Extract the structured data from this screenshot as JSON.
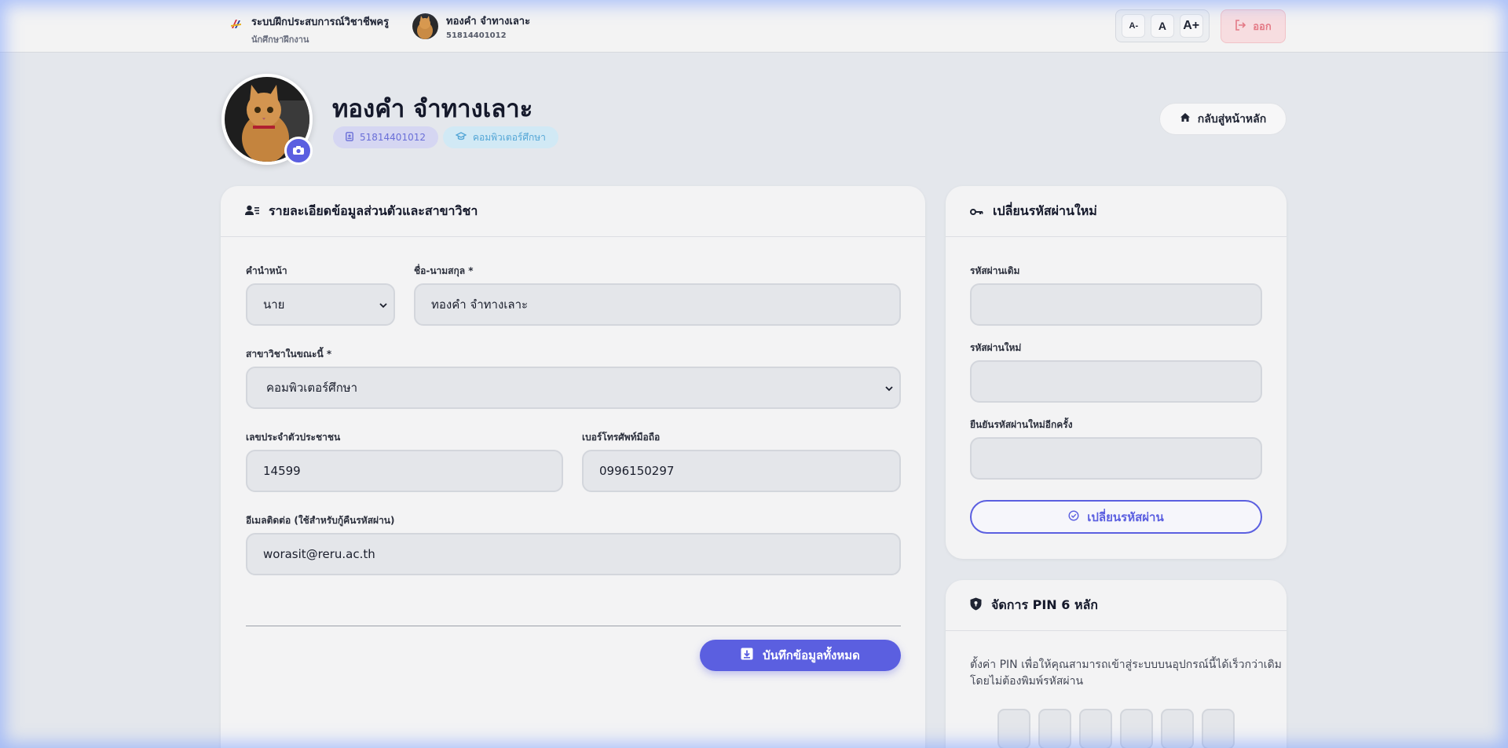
{
  "header": {
    "system_title": "ระบบฝึกประสบการณ์วิชาชีพครู",
    "role": "นักศึกษาฝึกงาน",
    "user_name": "ทองคำ จำทางเลาะ",
    "user_id": "51814401012",
    "font_controls": [
      "A-",
      "A",
      "A+"
    ],
    "logout_label": "ออก"
  },
  "profile": {
    "name": "ทองคำ จำทางเลาะ",
    "student_id": "51814401012",
    "major": "คอมพิวเตอร์ศึกษา",
    "home_label": "กลับสู่หน้าหลัก"
  },
  "details_card": {
    "title": "รายละเอียดข้อมูลส่วนตัวและสาขาวิชา",
    "prefix_label": "คำนำหน้า",
    "prefix_value": "นาย",
    "fullname_label": "ชื่อ-นามสกุล *",
    "fullname_value": "ทองคำ จำทางเลาะ",
    "major_label": "สาขาวิชาในขณะนี้ *",
    "major_value": "คอมพิวเตอร์ศึกษา",
    "citizen_label": "เลขประจำตัวประชาชน",
    "citizen_value": "14599",
    "phone_label": "เบอร์โทรศัพท์มือถือ",
    "phone_value": "0996150297",
    "email_label": "อีเมลติดต่อ (ใช้สำหรับกู้คืนรหัสผ่าน)",
    "email_value": "worasit@reru.ac.th",
    "save_label": "บันทึกข้อมูลทั้งหมด"
  },
  "password_card": {
    "title": "เปลี่ยนรหัสผ่านใหม่",
    "old_label": "รหัสผ่านเดิม",
    "new_label": "รหัสผ่านใหม่",
    "confirm_label": "ยืนยันรหัสผ่านใหม่อีกครั้ง",
    "submit_label": "เปลี่ยนรหัสผ่าน"
  },
  "pin_card": {
    "title": "จัดการ PIN 6 หลัก",
    "description_line1": "ตั้งค่า PIN เพื่อให้คุณสามารถเข้าสู่ระบบบนอุปกรณ์นี้ได้เร็วกว่าเดิม",
    "description_line2": "โดยไม่ต้องพิมพ์รหัสผ่าน"
  },
  "colors": {
    "accent": "#5b5fe0",
    "logout": "#e47a86",
    "chip_id": "#6a6fd8",
    "chip_major": "#54a6d6"
  },
  "icons": [
    "logo-icon",
    "logout-icon",
    "camera-icon",
    "id-badge-icon",
    "graduation-cap-icon",
    "home-icon",
    "user-details-icon",
    "key-icon",
    "check-circle-icon",
    "save-icon",
    "shield-icon",
    "chevron-down-icon"
  ]
}
